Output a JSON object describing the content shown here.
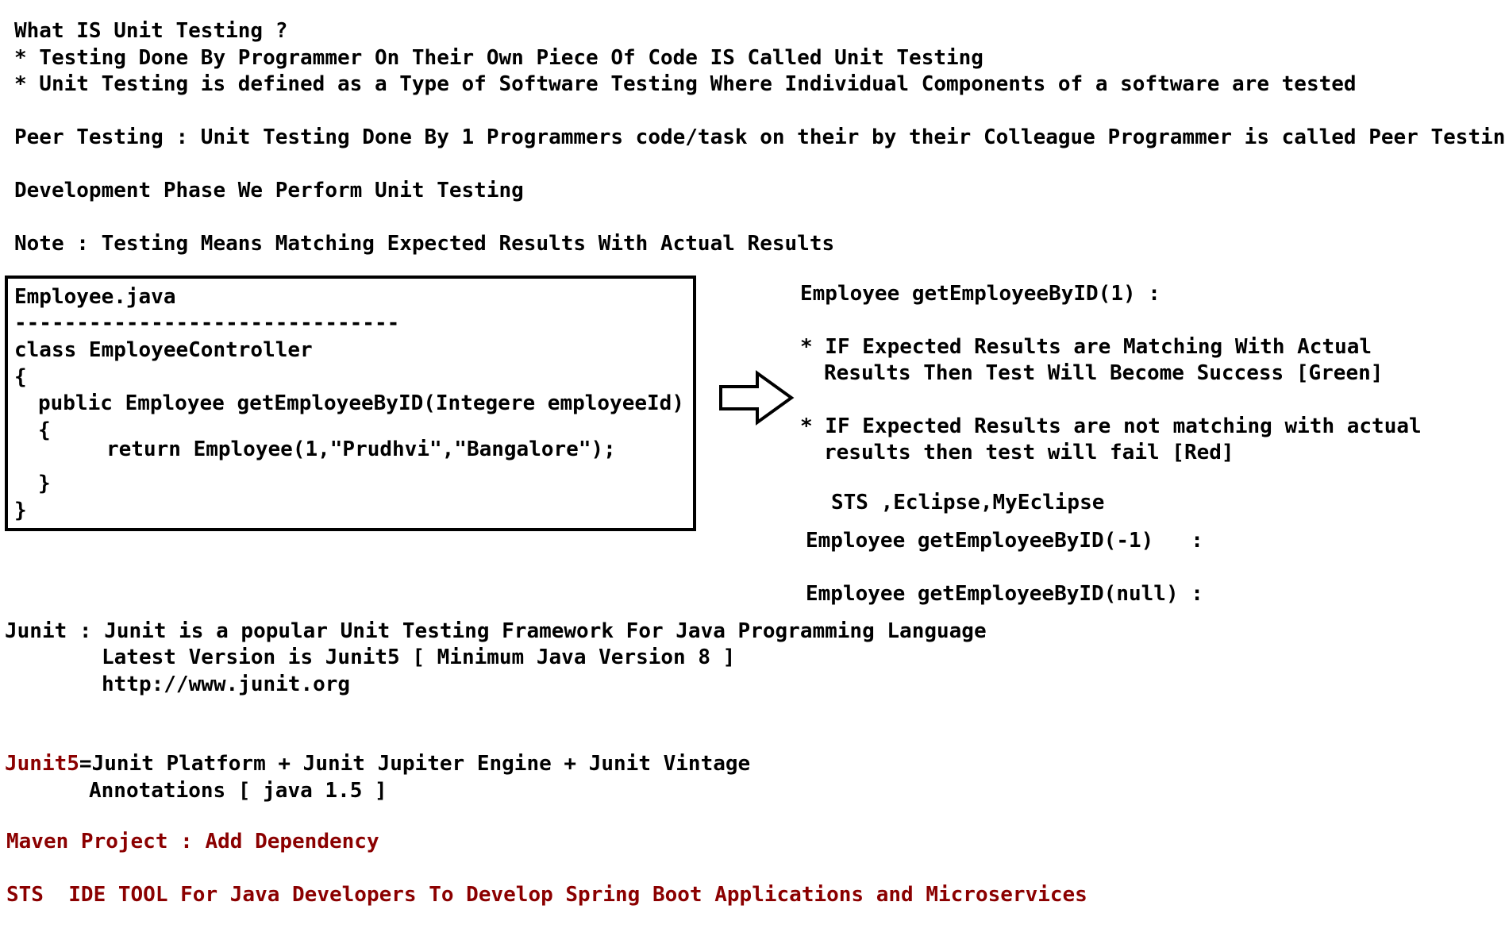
{
  "intro": {
    "title": "What IS Unit Testing ?",
    "bullet1": "* Testing Done By Programmer On Their Own Piece Of Code IS Called Unit Testing",
    "bullet2": "* Unit Testing is defined as a Type of Software Testing Where Individual Components of a software are tested",
    "peer": "Peer Testing : Unit Testing Done By 1 Programmers code/task on their by their Colleague Programmer is called Peer Testing",
    "phase": "Development Phase We Perform Unit Testing",
    "note": "Note : Testing Means Matching Expected Results With Actual Results"
  },
  "code": {
    "filename": "Employee.java",
    "separator": "-------------------------------",
    "class_line": "class EmployeeController",
    "open_brace": "{",
    "method_line": "public Employee getEmployeeByID(Integere employeeId)",
    "method_open": "{",
    "return_line": "return Employee(1,\"Prudhvi\",\"Bangalore\");",
    "method_close": "}",
    "close_brace": "}"
  },
  "right": {
    "call1": "Employee getEmployeeByID(1) :",
    "success1": "* IF Expected Results are Matching With Actual",
    "success2": "Results Then Test Will Become Success [Green]",
    "fail1": "* IF Expected Results are not matching with actual",
    "fail2": "results then test will fail [Red]",
    "ides": "STS ,Eclipse,MyEclipse",
    "call2": "Employee getEmployeeByID(-1)   :",
    "call3": "Employee getEmployeeByID(null) :"
  },
  "junit": {
    "line1": "Junit : Junit is a popular Unit Testing Framework For Java Programming Language",
    "line2": "Latest Version is Junit5 [ Minimum Java Version 8 ]",
    "line3": "http://www.junit.org",
    "junit5_label": "Junit5",
    "junit5_rest": "=Junit Platform + Junit Jupiter Engine + Junit Vintage",
    "annotations": "Annotations [ java 1.5 ]",
    "maven": "Maven Project : Add Dependency",
    "sts": "STS  IDE TOOL For Java Developers To Develop Spring Boot Applications and Microservices"
  },
  "colors": {
    "text": "#000000",
    "accent_red": "#8b0000"
  },
  "icons": {
    "arrow": "right-arrow-icon"
  }
}
